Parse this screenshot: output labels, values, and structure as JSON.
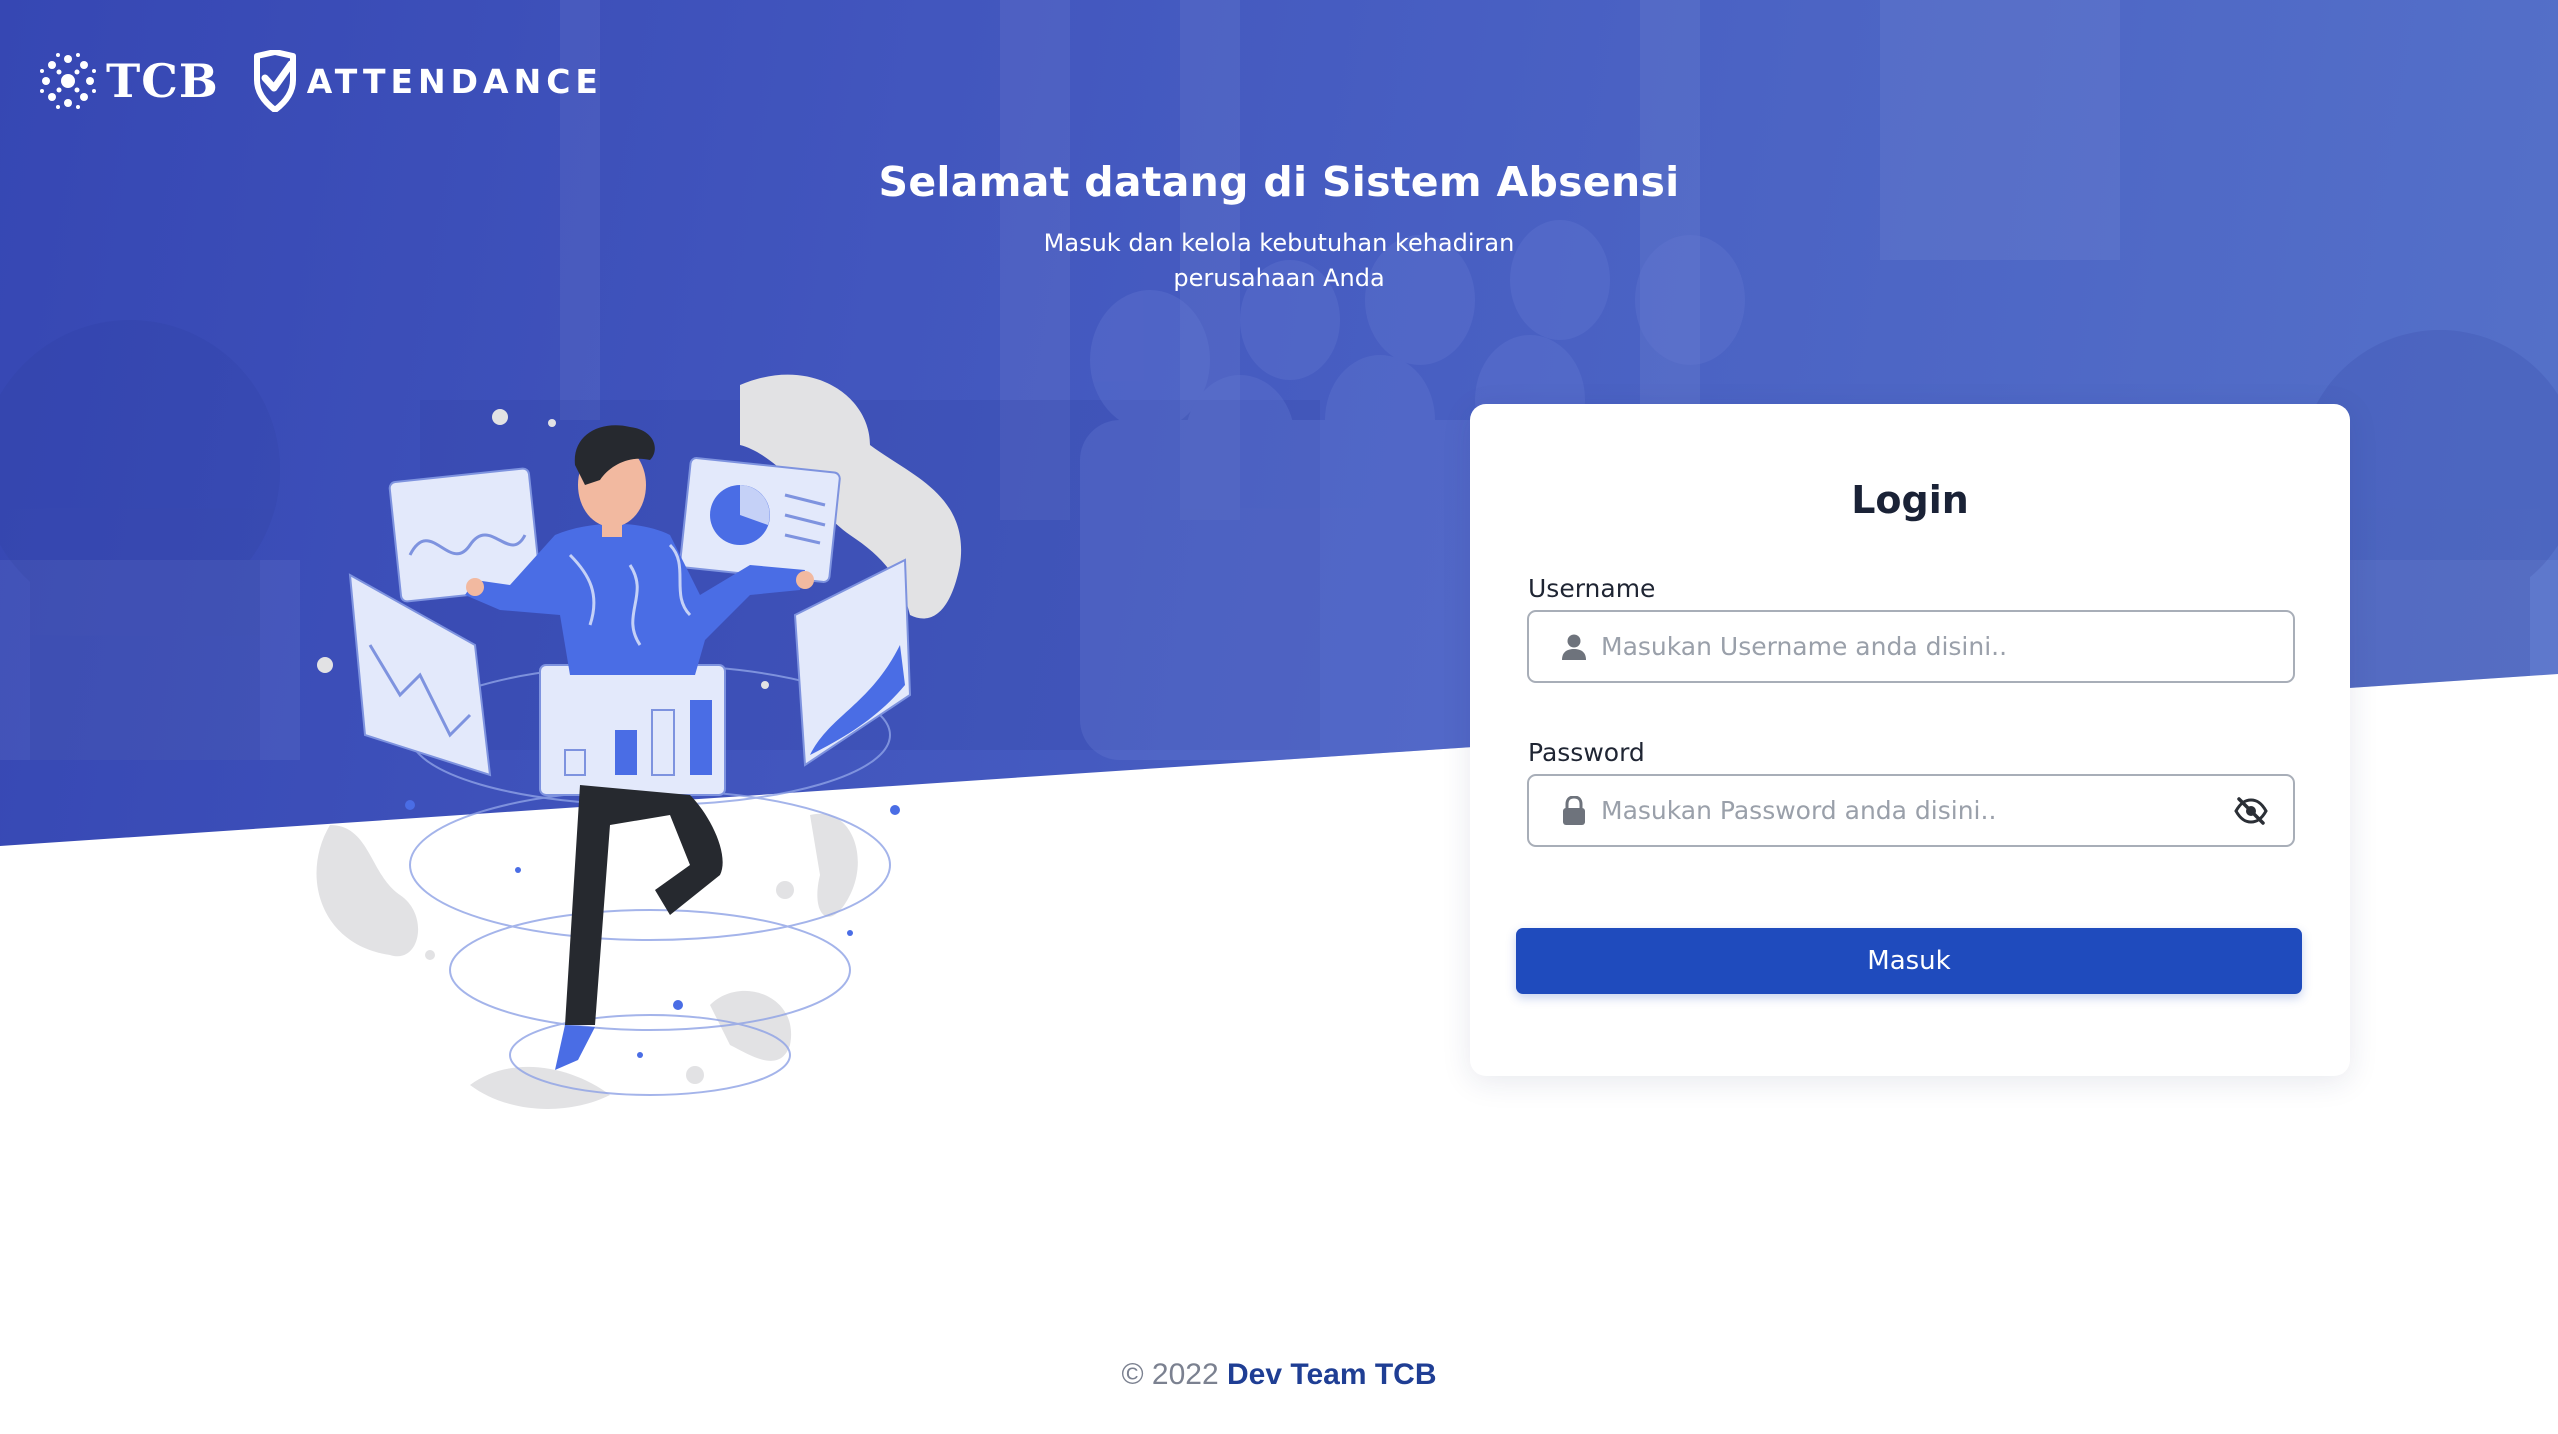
{
  "brand": {
    "tcb_label": "TCB",
    "attendance_label": "ATTENDANCE"
  },
  "hero": {
    "title": "Selamat datang di Sistem Absensi",
    "subtitle": "Masuk dan kelola kebutuhan kehadiran perusahaan Anda"
  },
  "login": {
    "title": "Login",
    "username_label": "Username",
    "username_placeholder": "Masukan Username anda disini..",
    "username_value": "",
    "password_label": "Password",
    "password_placeholder": "Masukan Password anda disini..",
    "password_value": "",
    "submit_label": "Masuk"
  },
  "footer": {
    "copyright": "© 2022",
    "team": "Dev Team TCB"
  },
  "icons": {
    "username": "user-icon",
    "password": "lock-icon",
    "toggle_password": "eye-slash-icon"
  },
  "colors": {
    "hero_bg": "#4256be",
    "primary_button": "#1f4bbd",
    "footer_link": "#1f3e94",
    "illustration_accent": "#4a6de5"
  }
}
